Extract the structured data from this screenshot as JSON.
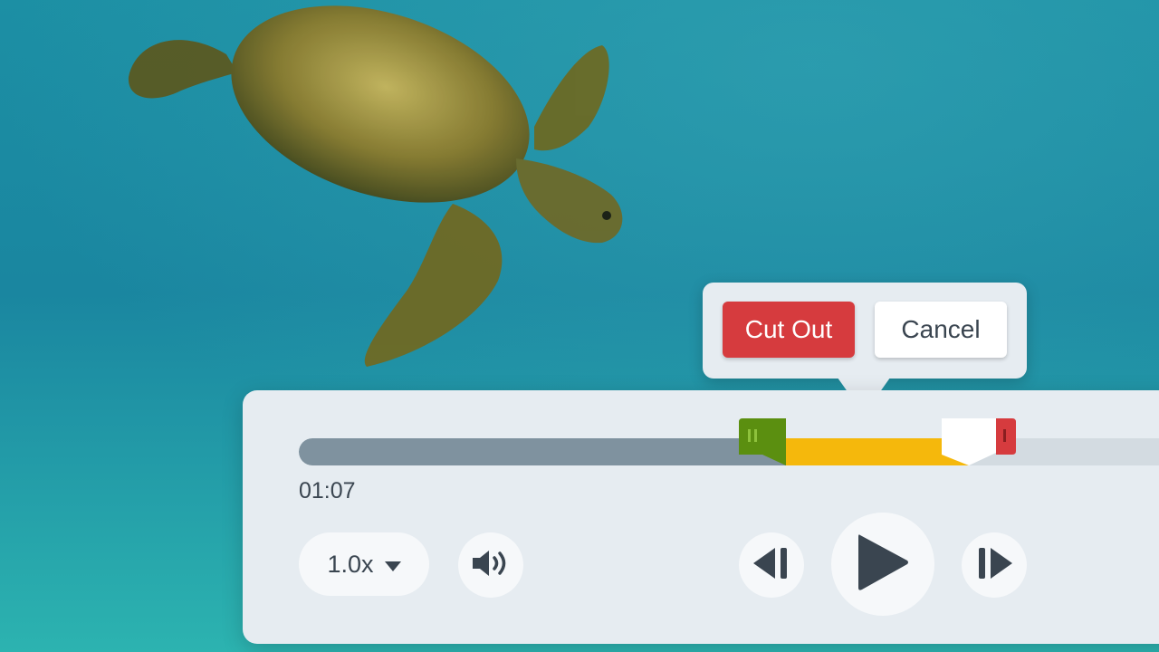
{
  "player": {
    "current_time": "01:07",
    "speed_label": "1.0x",
    "progress_fraction": 0.549,
    "selection_start_fraction": 0.549,
    "selection_end_fraction": 0.755
  },
  "popup": {
    "cut_out_label": "Cut Out",
    "cancel_label": "Cancel"
  },
  "colors": {
    "accent_red": "#d63b3e",
    "selection_yellow": "#f5b80c",
    "start_handle_green": "#5b8f10",
    "panel_bg": "#e6ecf1",
    "played_track": "#7f929f"
  },
  "icons": {
    "speed_dropdown": "chevron-down-icon",
    "volume": "speaker-icon",
    "prev": "skip-back-icon",
    "play": "play-icon",
    "next": "skip-forward-icon"
  }
}
